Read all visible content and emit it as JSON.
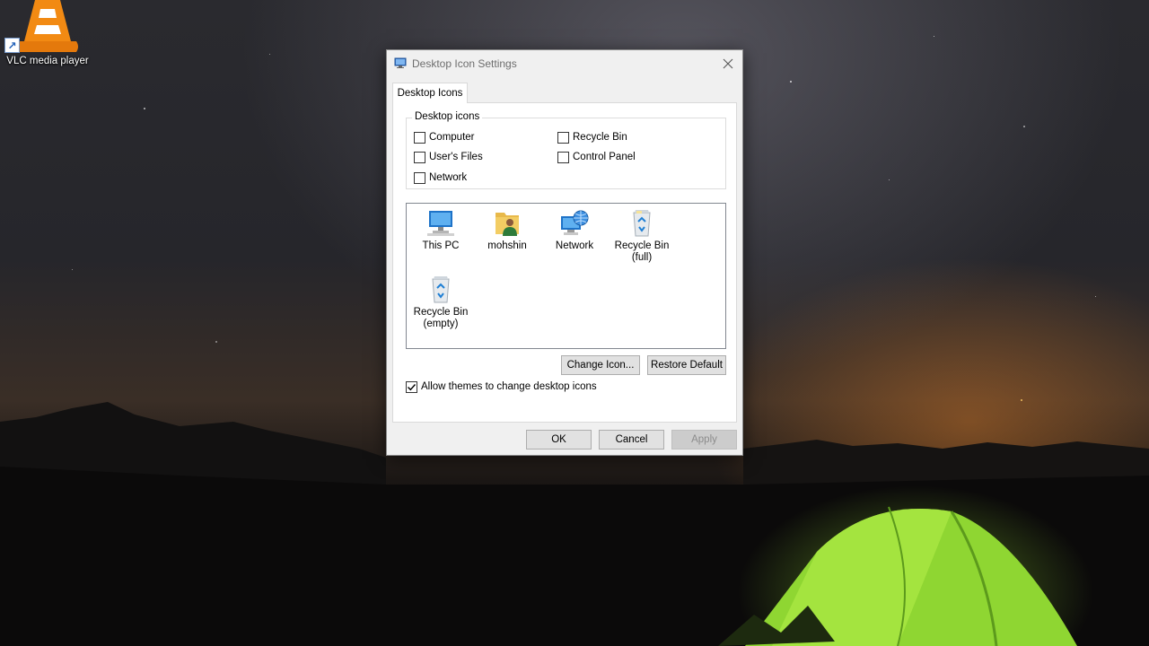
{
  "desktop": {
    "shortcut": {
      "label": "VLC media player",
      "icon": "vlc-cone-icon"
    }
  },
  "dialog": {
    "title": "Desktop Icon Settings",
    "title_icon": "desktop-settings-icon",
    "close_icon": "close-icon",
    "tab": "Desktop Icons",
    "group_title": "Desktop icons",
    "checkboxes": [
      {
        "label": "Computer",
        "checked": false
      },
      {
        "label": "Recycle Bin",
        "checked": false
      },
      {
        "label": "User's Files",
        "checked": false
      },
      {
        "label": "Control Panel",
        "checked": false
      },
      {
        "label": "Network",
        "checked": false
      }
    ],
    "icons": [
      {
        "label": "This PC",
        "icon": "this-pc-icon"
      },
      {
        "label": "mohshin",
        "icon": "user-folder-icon"
      },
      {
        "label": "Network",
        "icon": "network-icon"
      },
      {
        "label": "Recycle Bin\n(full)",
        "line1": "Recycle Bin",
        "line2": "(full)",
        "icon": "recycle-bin-full-icon"
      },
      {
        "label": "Recycle Bin\n(empty)",
        "line1": "Recycle Bin",
        "line2": "(empty)",
        "icon": "recycle-bin-empty-icon"
      }
    ],
    "buttons": {
      "change_icon": "Change Icon...",
      "restore_default": "Restore Default",
      "ok": "OK",
      "cancel": "Cancel",
      "apply": "Apply"
    },
    "allow_themes": {
      "label": "Allow themes to change desktop icons",
      "checked": true
    }
  },
  "colors": {
    "dialog_bg": "#f0f0f0",
    "panel_bg": "#ffffff",
    "button_bg": "#e1e1e1",
    "disabled_text": "#8c8c8c"
  }
}
